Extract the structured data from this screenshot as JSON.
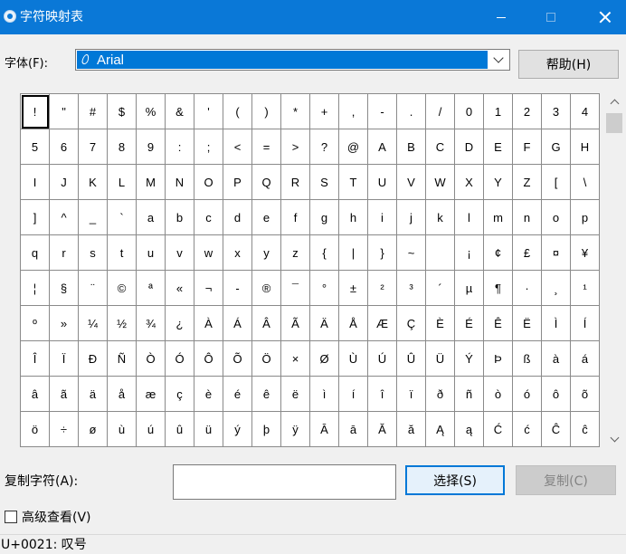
{
  "window": {
    "title": "字符映射表",
    "icon": "character-map-icon"
  },
  "font": {
    "label": "字体(F):",
    "selected": "Arial",
    "icon": "opentype-font-icon"
  },
  "buttons": {
    "help": "帮助(H)",
    "select": "选择(S)",
    "copy": "复制(C)"
  },
  "copy_field": {
    "label": "复制字符(A):",
    "value": ""
  },
  "advanced": {
    "label": "高级查看(V)",
    "checked": false
  },
  "status": {
    "text": "U+0021: 叹号"
  },
  "selected_char": "!",
  "characters": [
    "!",
    "\"",
    "#",
    "$",
    "%",
    "&",
    "'",
    "(",
    ")",
    "*",
    "+",
    ",",
    "-",
    ".",
    "/",
    "0",
    "1",
    "2",
    "3",
    "4",
    "5",
    "6",
    "7",
    "8",
    "9",
    ":",
    ";",
    "<",
    "=",
    ">",
    "?",
    "@",
    "A",
    "B",
    "C",
    "D",
    "E",
    "F",
    "G",
    "H",
    "I",
    "J",
    "K",
    "L",
    "M",
    "N",
    "O",
    "P",
    "Q",
    "R",
    "S",
    "T",
    "U",
    "V",
    "W",
    "X",
    "Y",
    "Z",
    "[",
    "\\",
    "]",
    "^",
    "_",
    "`",
    "a",
    "b",
    "c",
    "d",
    "e",
    "f",
    "g",
    "h",
    "i",
    "j",
    "k",
    "l",
    "m",
    "n",
    "o",
    "p",
    "q",
    "r",
    "s",
    "t",
    "u",
    "v",
    "w",
    "x",
    "y",
    "z",
    "{",
    "|",
    "}",
    "~",
    " ",
    "¡",
    "¢",
    "£",
    "¤",
    "¥",
    "¦",
    "§",
    "¨",
    "©",
    "ª",
    "«",
    "¬",
    "-",
    "®",
    "¯",
    "°",
    "±",
    "²",
    "³",
    "´",
    "µ",
    "¶",
    "·",
    "¸",
    "¹",
    "º",
    "»",
    "¼",
    "½",
    "¾",
    "¿",
    "À",
    "Á",
    "Â",
    "Ã",
    "Ä",
    "Å",
    "Æ",
    "Ç",
    "È",
    "É",
    "Ê",
    "Ë",
    "Ì",
    "Í",
    "Î",
    "Ï",
    "Ð",
    "Ñ",
    "Ò",
    "Ó",
    "Ô",
    "Õ",
    "Ö",
    "×",
    "Ø",
    "Ù",
    "Ú",
    "Û",
    "Ü",
    "Ý",
    "Þ",
    "ß",
    "à",
    "á",
    "â",
    "ã",
    "ä",
    "å",
    "æ",
    "ç",
    "è",
    "é",
    "ê",
    "ë",
    "ì",
    "í",
    "î",
    "ï",
    "ð",
    "ñ",
    "ò",
    "ó",
    "ô",
    "õ",
    "ö",
    "÷",
    "ø",
    "ù",
    "ú",
    "û",
    "ü",
    "ý",
    "þ",
    "ÿ",
    "Ā",
    "ā",
    "Ă",
    "ă",
    "Ą",
    "ą",
    "Ć",
    "ć",
    "Ĉ",
    "ĉ"
  ]
}
